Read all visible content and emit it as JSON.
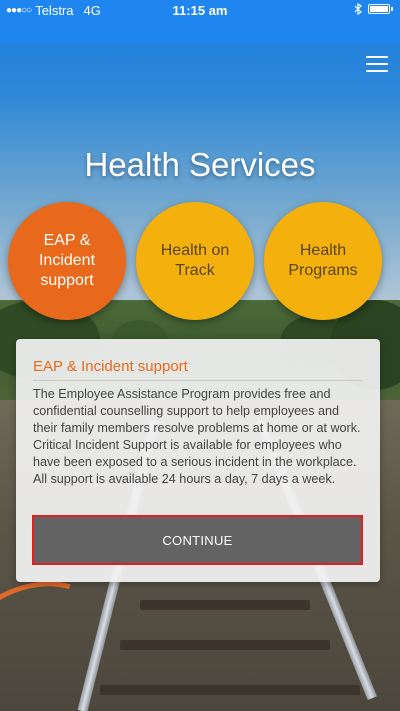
{
  "status_bar": {
    "carrier": "Telstra",
    "network": "4G",
    "time": "11:15 am"
  },
  "page": {
    "title": "Health Services"
  },
  "categories": [
    {
      "label": "EAP & Incident support",
      "selected": true,
      "color": "#e8691c"
    },
    {
      "label": "Health on Track",
      "selected": false,
      "color": "#f4b00c"
    },
    {
      "label": "Health Programs",
      "selected": false,
      "color": "#f4b00c"
    }
  ],
  "info_card": {
    "title": "EAP & Incident support",
    "body": "The Employee Assistance Program provides free and confidential counselling support to help employees and their family members resolve problems at home or at work. Critical Incident Support is available for employees who have been exposed to a serious incident in the workplace. All support is available 24 hours a day, 7 days a week.",
    "button_label": "CONTINUE"
  },
  "icons": {
    "menu": "hamburger-menu-icon",
    "bluetooth": "bluetooth-icon",
    "battery": "battery-icon",
    "signal": "signal-icon"
  },
  "colors": {
    "header_blue": "#1f86f0",
    "accent_orange": "#e8691c",
    "accent_yellow": "#f4b00c",
    "button_gray": "#636363",
    "button_border": "#e02020"
  }
}
